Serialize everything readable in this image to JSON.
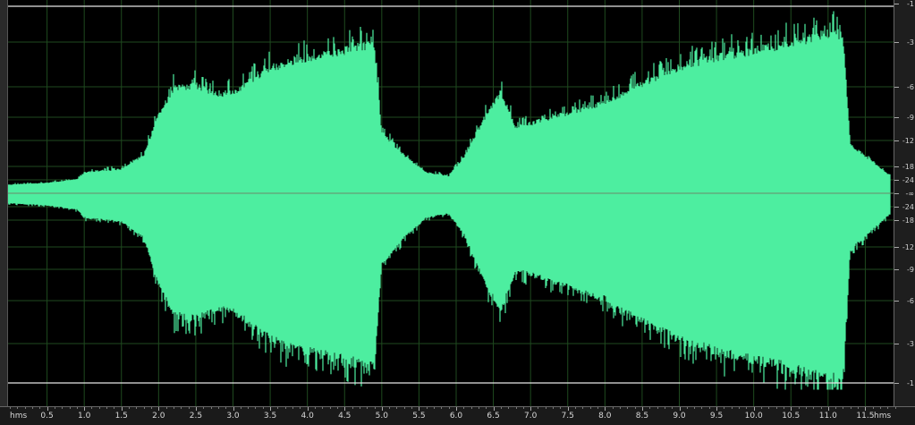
{
  "colors": {
    "background": "#000000",
    "waveform": "#4deea0",
    "grid": "#1f4a1f",
    "clip_line": "#e6e6e6",
    "center_line": "#6a8a6a"
  },
  "time_ruler": {
    "unit_left": "hms",
    "unit_right": "hms",
    "ticks": [
      "0.5",
      "1.0",
      "1.5",
      "2.0",
      "2.5",
      "3.0",
      "3.5",
      "4.0",
      "4.5",
      "5.0",
      "5.5",
      "6.0",
      "6.5",
      "7.0",
      "7.5",
      "8.0",
      "8.5",
      "9.0",
      "9.5",
      "10.0",
      "10.5",
      "11.0",
      "11.5"
    ]
  },
  "db_ruler": {
    "top_labels": [
      "-1",
      "-3",
      "-6",
      "-9",
      "-12",
      "-18",
      "-24"
    ],
    "center_label": "-∞",
    "bottom_labels": [
      "-24",
      "-18",
      "-12",
      "-9",
      "-6",
      "-3",
      "-1"
    ]
  },
  "waveform": {
    "duration_seconds": 11.84,
    "envelope": [
      [
        0.0,
        0.05
      ],
      [
        0.5,
        0.06
      ],
      [
        0.9,
        0.08
      ],
      [
        1.0,
        0.12
      ],
      [
        1.5,
        0.14
      ],
      [
        1.8,
        0.22
      ],
      [
        2.0,
        0.45
      ],
      [
        2.2,
        0.6
      ],
      [
        2.5,
        0.62
      ],
      [
        2.8,
        0.57
      ],
      [
        3.0,
        0.58
      ],
      [
        3.5,
        0.72
      ],
      [
        4.0,
        0.78
      ],
      [
        4.5,
        0.82
      ],
      [
        4.9,
        0.86
      ],
      [
        5.0,
        0.35
      ],
      [
        5.3,
        0.22
      ],
      [
        5.6,
        0.12
      ],
      [
        5.9,
        0.1
      ],
      [
        6.1,
        0.2
      ],
      [
        6.4,
        0.45
      ],
      [
        6.6,
        0.58
      ],
      [
        6.8,
        0.38
      ],
      [
        7.0,
        0.4
      ],
      [
        7.5,
        0.46
      ],
      [
        8.0,
        0.52
      ],
      [
        8.5,
        0.63
      ],
      [
        9.0,
        0.72
      ],
      [
        9.5,
        0.78
      ],
      [
        10.0,
        0.82
      ],
      [
        10.5,
        0.86
      ],
      [
        11.0,
        0.92
      ],
      [
        11.2,
        0.9
      ],
      [
        11.3,
        0.28
      ],
      [
        11.6,
        0.18
      ],
      [
        11.84,
        0.1
      ]
    ]
  }
}
